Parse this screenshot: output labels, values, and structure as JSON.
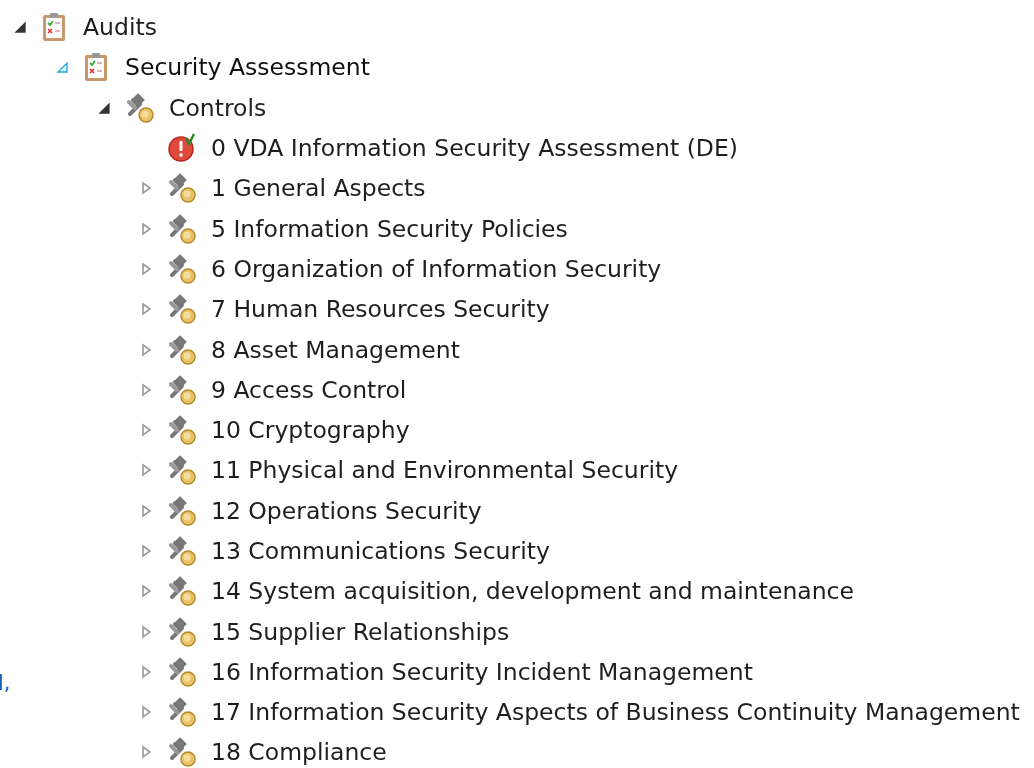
{
  "tree": [
    {
      "label": "Audits",
      "kind": "audit",
      "expandable": true,
      "expanded": true,
      "highlighted": false,
      "children": [
        {
          "label": "Security Assessment",
          "kind": "audit",
          "expandable": true,
          "expanded": true,
          "highlighted": true,
          "children": [
            {
              "label": "Controls",
              "kind": "controls",
              "expandable": true,
              "expanded": true,
              "highlighted": false,
              "children": [
                {
                  "label": "0 VDA Information Security Assessment (DE)",
                  "kind": "alert",
                  "expandable": false,
                  "highlighted": false
                },
                {
                  "label": "1 General Aspects",
                  "kind": "controls",
                  "expandable": true,
                  "expanded": false,
                  "highlighted": false
                },
                {
                  "label": "5 Information Security Policies",
                  "kind": "controls",
                  "expandable": true,
                  "expanded": false,
                  "highlighted": false
                },
                {
                  "label": "6 Organization of Information Security",
                  "kind": "controls",
                  "expandable": true,
                  "expanded": false,
                  "highlighted": false
                },
                {
                  "label": "7 Human Resources Security",
                  "kind": "controls",
                  "expandable": true,
                  "expanded": false,
                  "highlighted": false
                },
                {
                  "label": "8 Asset Management",
                  "kind": "controls",
                  "expandable": true,
                  "expanded": false,
                  "highlighted": false
                },
                {
                  "label": "9 Access Control",
                  "kind": "controls",
                  "expandable": true,
                  "expanded": false,
                  "highlighted": false
                },
                {
                  "label": "10 Cryptography",
                  "kind": "controls",
                  "expandable": true,
                  "expanded": false,
                  "highlighted": false
                },
                {
                  "label": "11 Physical and Environmental Security",
                  "kind": "controls",
                  "expandable": true,
                  "expanded": false,
                  "highlighted": false
                },
                {
                  "label": "12 Operations Security",
                  "kind": "controls",
                  "expandable": true,
                  "expanded": false,
                  "highlighted": false
                },
                {
                  "label": "13 Communications Security",
                  "kind": "controls",
                  "expandable": true,
                  "expanded": false,
                  "highlighted": false
                },
                {
                  "label": "14 System acquisition, development and maintenance",
                  "kind": "controls",
                  "expandable": true,
                  "expanded": false,
                  "highlighted": false
                },
                {
                  "label": "15 Supplier Relationships",
                  "kind": "controls",
                  "expandable": true,
                  "expanded": false,
                  "highlighted": false
                },
                {
                  "label": "16 Information Security Incident Management",
                  "kind": "controls",
                  "expandable": true,
                  "expanded": false,
                  "highlighted": false
                },
                {
                  "label": "17 Information Security Aspects of Business Continuity Management",
                  "kind": "controls",
                  "expandable": true,
                  "expanded": false,
                  "highlighted": false
                },
                {
                  "label": "18 Compliance",
                  "kind": "controls",
                  "expandable": true,
                  "expanded": false,
                  "highlighted": false
                }
              ]
            }
          ]
        }
      ]
    }
  ],
  "side_fragment": "l,"
}
